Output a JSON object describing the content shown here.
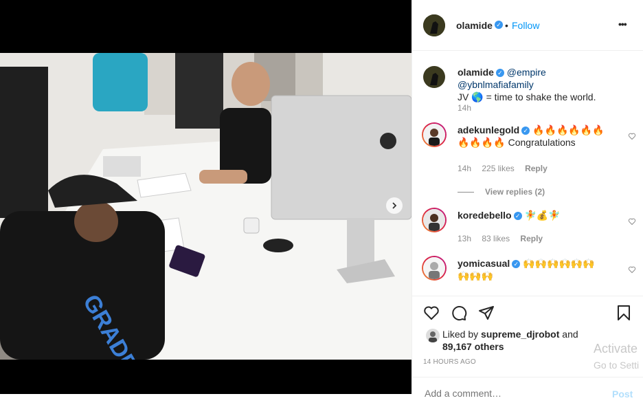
{
  "header": {
    "username": "olamide",
    "follow_label": "Follow",
    "more_label": "•••",
    "separator": "•"
  },
  "caption": {
    "username": "olamide",
    "mention1": "@empire",
    "mention2": "@ybnlmafiafamily",
    "text_prefix": "JV",
    "text_suffix": "= time to shake the world.",
    "time": "14h"
  },
  "comments": [
    {
      "username": "adekunlegold",
      "text_line1": "🔥🔥🔥🔥🔥🔥",
      "text_line2": "🔥🔥🔥🔥 Congratulations",
      "time": "14h",
      "likes": "225 likes",
      "reply": "Reply",
      "view_replies": "View replies (2)"
    },
    {
      "username": "koredebello",
      "text_line1": "🧚💰🧚",
      "time": "13h",
      "likes": "83 likes",
      "reply": "Reply"
    },
    {
      "username": "yomicasual",
      "text_line1": "🙌🙌🙌🙌🙌🙌",
      "text_line2": "🙌🙌🙌"
    }
  ],
  "likes": {
    "prefix": "Liked by",
    "user": "supreme_djrobot",
    "mid": "and",
    "count": "89,167 others"
  },
  "timestamp": "14 HOURS AGO",
  "comment_input": {
    "placeholder": "Add a comment…",
    "post_label": "Post"
  },
  "watermark": {
    "line1": "Activate",
    "line2": "Go to Setti"
  },
  "colors": {
    "accent": "#0095f6",
    "verified": "#3897f0",
    "muted": "#8e8e8e"
  }
}
